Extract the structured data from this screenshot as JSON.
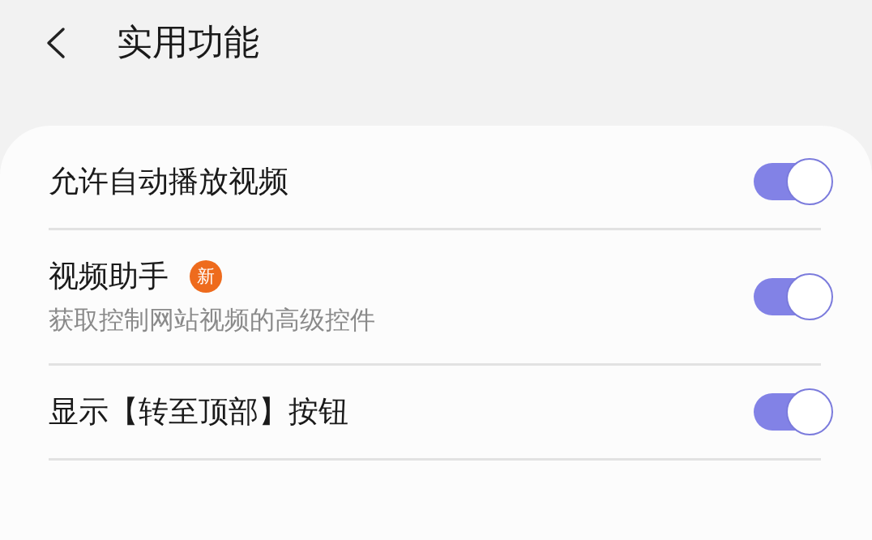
{
  "header": {
    "title": "实用功能"
  },
  "settings": [
    {
      "title": "允许自动播放视频",
      "on": true
    },
    {
      "title": "视频助手",
      "badge": "新",
      "subtitle": "获取控制网站视频的高级控件",
      "on": true
    },
    {
      "title": "显示【转至顶部】按钮",
      "on": true
    }
  ]
}
